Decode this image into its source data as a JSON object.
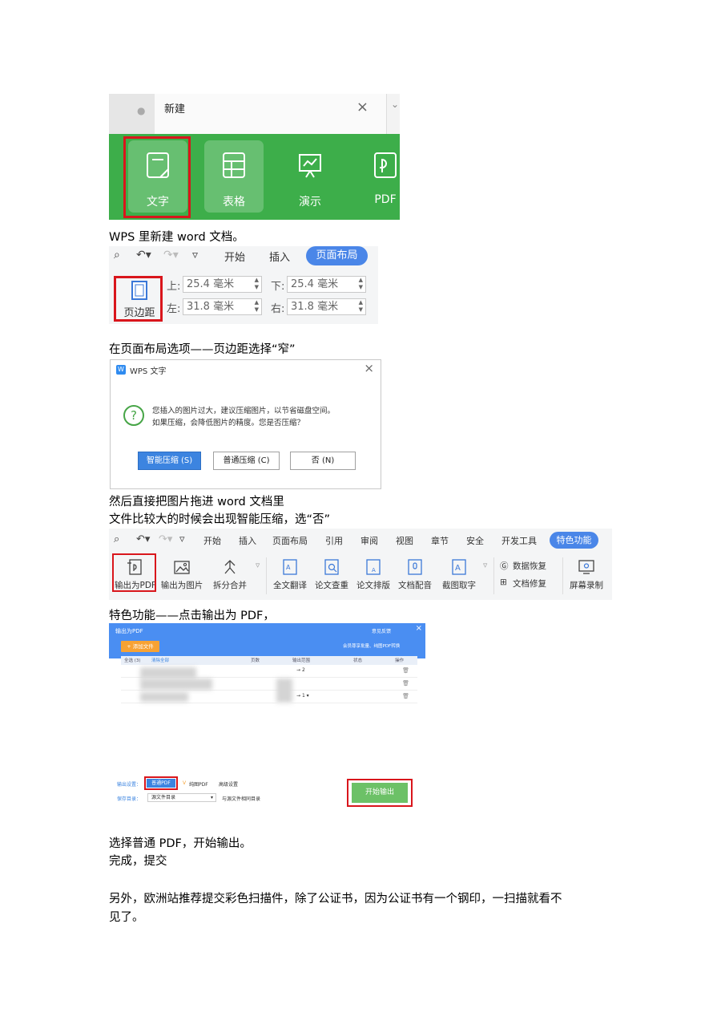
{
  "shot_new": {
    "tab_title": "新建",
    "tab_close": "×",
    "tab_dot": "●",
    "tiles": [
      "文字",
      "表格",
      "演示",
      "PDF"
    ],
    "colors": {
      "ribbon": "#3dae4a",
      "highlight": "#d9161c"
    }
  },
  "caption_1": "WPS 里新建 word 文档。",
  "shot_margins": {
    "tabs": [
      "开始",
      "插入",
      "页面布局"
    ],
    "margin_button": "页边距",
    "fields": [
      {
        "label": "上:",
        "value": "25.4 毫米"
      },
      {
        "label": "下:",
        "value": "25.4 毫米"
      },
      {
        "label": "左:",
        "value": "31.8 毫米"
      },
      {
        "label": "右:",
        "value": "31.8 毫米"
      }
    ]
  },
  "caption_2": "在页面布局选项——页边距选择“窄”",
  "shot_dialog": {
    "title": "WPS 文字",
    "logo": "W",
    "message_line1": "您插入的图片过大，建议压缩图片，以节省磁盘空间。",
    "message_line2": "如果压缩，会降低图片的精度。您是否压缩？",
    "buttons": [
      "智能压缩 (S)",
      "普通压缩 (C)",
      "否 (N)"
    ],
    "question_mark": "?"
  },
  "caption_3": "然后直接把图片拖进 word 文档里",
  "caption_4": "文件比较大的时候会出现智能压缩，选“否”",
  "shot_features": {
    "tabs": [
      "开始",
      "插入",
      "页面布局",
      "引用",
      "审阅",
      "视图",
      "章节",
      "安全",
      "开发工具",
      "特色功能"
    ],
    "tools": [
      "输出为PDF",
      "输出为图片",
      "拆分合并",
      "全文翻译",
      "论文查重",
      "论文排版",
      "文档配音",
      "截图取字",
      "屏幕录制"
    ],
    "small_tools": [
      "数据恢复",
      "文档修复"
    ]
  },
  "caption_5": "特色功能——点击输出为 PDF，",
  "shot_export": {
    "title": "输出为PDF",
    "feedback": "意见反馈",
    "add_file": "+ 添加文件",
    "promo": "会员尊享批量、纯图PDF转换",
    "columns": [
      "全选 (3)",
      "清除全部",
      "页数",
      "输出范围",
      "状态",
      "操作"
    ],
    "ranges": [
      {
        "to": "2"
      },
      {
        "to": "1"
      }
    ]
  },
  "shot_output": {
    "output_label": "输出设置：",
    "normal_pdf": "普通PDF",
    "image_pdf": "纯图PDF",
    "advanced": "高级设置",
    "save_label": "保存目录：",
    "save_dir": "源文件目录",
    "browse_hint": "与源文件相同目录",
    "start_button": "开始输出"
  },
  "caption_6": "选择普通 PDF，开始输出。",
  "caption_7": "完成，提交",
  "caption_8": "另外，欧洲站推荐提交彩色扫描件，除了公证书，因为公证书有一个钢印，一扫描就看不",
  "caption_9": "见了。"
}
